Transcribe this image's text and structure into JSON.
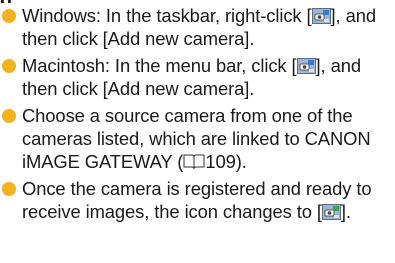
{
  "heading_fragment": "g",
  "items": [
    {
      "before_icon": "Windows: In the taskbar, right-click [",
      "after_icon": "], and then click [Add new camera].",
      "icon": "camera-connection-icon"
    },
    {
      "before_icon": "Macintosh: In the menu bar, click [",
      "after_icon": "], and then click [Add new camera].",
      "icon": "camera-connection-icon"
    },
    {
      "before_icon": "Choose a source camera from one of the cameras listed, which are linked to CANON iMAGE GATEWAY (",
      "after_icon": "109).",
      "icon": "book-reference-icon"
    },
    {
      "before_icon": "Once the camera is registered and ready to receive images, the icon changes to [",
      "after_icon": "].",
      "icon": "camera-ready-icon"
    }
  ],
  "colors": {
    "bullet": "#f5b318",
    "text": "#1a1a1a"
  }
}
